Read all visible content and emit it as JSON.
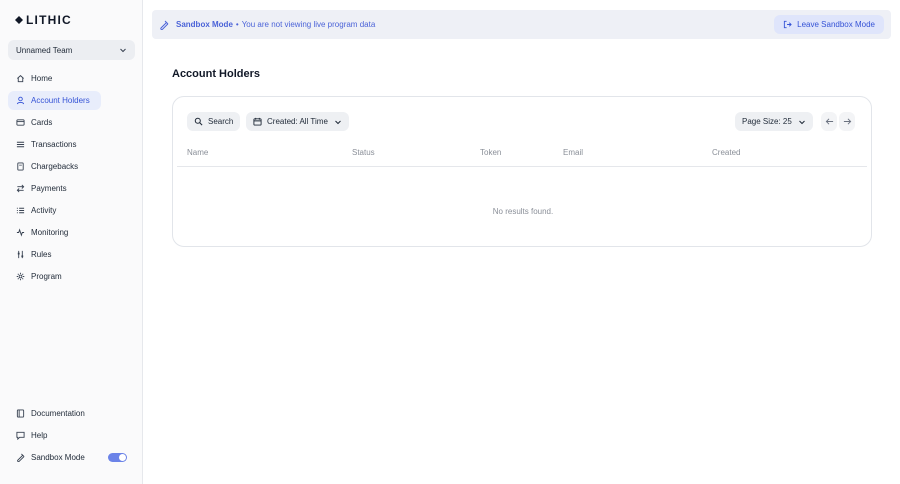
{
  "app": {
    "logo_text": "LITHIC",
    "team_name": "Unnamed Team"
  },
  "sidebar": {
    "items": [
      {
        "label": "Home",
        "icon": "home-icon"
      },
      {
        "label": "Account Holders",
        "icon": "user-icon"
      },
      {
        "label": "Cards",
        "icon": "card-icon"
      },
      {
        "label": "Transactions",
        "icon": "list-icon"
      },
      {
        "label": "Chargebacks",
        "icon": "document-icon"
      },
      {
        "label": "Payments",
        "icon": "transfer-icon"
      },
      {
        "label": "Activity",
        "icon": "activity-list-icon"
      },
      {
        "label": "Monitoring",
        "icon": "pulse-icon"
      },
      {
        "label": "Rules",
        "icon": "sliders-icon"
      },
      {
        "label": "Program",
        "icon": "gear-icon"
      }
    ],
    "bottom": {
      "documentation": "Documentation",
      "help": "Help",
      "sandbox_mode": "Sandbox Mode",
      "sandbox_enabled": true
    }
  },
  "banner": {
    "mode": "Sandbox Mode",
    "separator": "•",
    "message": "You are not viewing live program data",
    "leave_label": "Leave Sandbox Mode"
  },
  "main": {
    "title": "Account Holders",
    "toolbar": {
      "search_label": "Search",
      "created_label": "Created: All Time",
      "page_size_label": "Page Size: 25"
    },
    "table": {
      "columns": [
        "Name",
        "Status",
        "Token",
        "Email",
        "Created"
      ],
      "rows": [],
      "empty_message": "No results found."
    }
  },
  "colors": {
    "accent": "#3553d6",
    "active_bg": "#e8edfb",
    "banner_bg": "#eef0f6"
  }
}
